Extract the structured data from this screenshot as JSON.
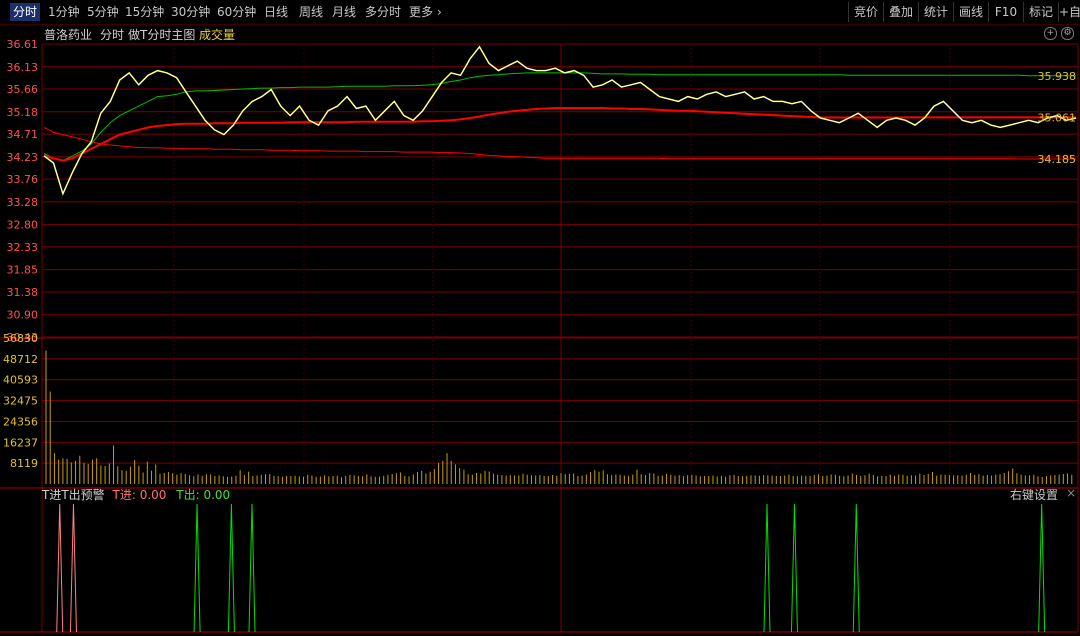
{
  "toolbar": {
    "tabs": [
      "分时",
      "1分钟",
      "5分钟",
      "15分钟",
      "30分钟",
      "60分钟",
      "日线",
      "周线",
      "月线",
      "多分时",
      "更多"
    ],
    "more_arrow": "›",
    "right_tabs": [
      "竞价",
      "叠加",
      "统计",
      "画线",
      "F10",
      "标记",
      "+自"
    ]
  },
  "info": {
    "stock_name": "普洛药业",
    "mode": "分时",
    "chart_name": "做T分时主图",
    "volume_label": "成交量"
  },
  "price_axis": [
    "36.61",
    "36.13",
    "35.66",
    "35.18",
    "34.71",
    "34.23",
    "33.76",
    "33.28",
    "32.80",
    "32.33",
    "31.85",
    "31.38",
    "30.90",
    "30.43"
  ],
  "volume_axis": [
    "56830",
    "48712",
    "40593",
    "32475",
    "24356",
    "16237",
    "8119"
  ],
  "line_labels": [
    "35.938",
    "35.061",
    "34.185"
  ],
  "indicator": {
    "title": "T进T出预警",
    "t_in": "T进: 0.00",
    "t_out": "T出: 0.00",
    "settings": "右键设置",
    "close": "×"
  },
  "colors": {
    "background": "#000000",
    "grid": "#7a0000",
    "price_line": "#ffffff",
    "avg_line": "#ffff00",
    "ma_red": "#ff0000",
    "ma_green": "#00c000",
    "axis_red": "#ff5050",
    "axis_yellow": "#e0c030",
    "volume_bar": "#c8a000",
    "t_in_spike": "#ff8080",
    "t_out_spike": "#00e000"
  },
  "chart_data": {
    "type": "line",
    "title": "",
    "ylim": [
      30.43,
      36.61
    ],
    "price": [
      34.25,
      34.1,
      33.45,
      33.9,
      34.3,
      34.55,
      35.15,
      35.4,
      35.85,
      36.0,
      35.75,
      35.95,
      36.05,
      36.0,
      35.9,
      35.6,
      35.3,
      35.0,
      34.8,
      34.7,
      34.9,
      35.2,
      35.4,
      35.5,
      35.65,
      35.3,
      35.1,
      35.3,
      35.0,
      34.9,
      35.2,
      35.3,
      35.5,
      35.25,
      35.3,
      35.0,
      35.2,
      35.4,
      35.1,
      35.0,
      35.2,
      35.5,
      35.8,
      36.0,
      35.95,
      36.3,
      36.55,
      36.2,
      36.05,
      36.15,
      36.25,
      36.1,
      36.05,
      36.05,
      36.1,
      36.0,
      36.05,
      35.95,
      35.7,
      35.75,
      35.85,
      35.7,
      35.75,
      35.8,
      35.65,
      35.5,
      35.45,
      35.4,
      35.5,
      35.45,
      35.55,
      35.6,
      35.5,
      35.55,
      35.6,
      35.45,
      35.5,
      35.4,
      35.4,
      35.35,
      35.4,
      35.2,
      35.05,
      35.0,
      34.95,
      35.05,
      35.15,
      35.0,
      34.85,
      35.0,
      35.05,
      35.0,
      34.9,
      35.05,
      35.3,
      35.4,
      35.2,
      35.0,
      34.95,
      35.0,
      34.9,
      34.85,
      34.9,
      34.95,
      35.0,
      34.95,
      35.05,
      35.1,
      35.0,
      35.05
    ],
    "series": [
      {
        "name": "",
        "values": [
          34.3,
          34.2,
          34.15,
          34.25,
          34.35,
          34.5,
          34.75,
          34.95,
          35.1,
          35.2,
          35.3,
          35.4,
          35.5,
          35.52,
          35.55,
          35.6,
          35.62,
          35.62,
          35.63,
          35.64,
          35.65,
          35.66,
          35.67,
          35.68,
          35.68,
          35.69,
          35.69,
          35.7,
          35.7,
          35.7,
          35.7,
          35.71,
          35.72,
          35.72,
          35.72,
          35.72,
          35.72,
          35.73,
          35.73,
          35.73,
          35.74,
          35.75,
          35.78,
          35.82,
          35.85,
          35.9,
          35.93,
          35.95,
          35.96,
          35.98,
          35.99,
          36.0,
          36.0,
          36.0,
          36.0,
          36.0,
          36.0,
          36.0,
          35.99,
          35.98,
          35.98,
          35.98,
          35.97,
          35.97,
          35.97,
          35.96,
          35.96,
          35.96,
          35.96,
          35.96,
          35.96,
          35.96,
          35.96,
          35.96,
          35.96,
          35.96,
          35.96,
          35.96,
          35.96,
          35.96,
          35.96,
          35.96,
          35.96,
          35.96,
          35.96,
          35.95,
          35.95,
          35.95,
          35.95,
          35.95,
          35.95,
          35.95,
          35.95,
          35.95,
          35.95,
          35.95,
          35.95,
          35.95,
          35.95,
          35.95,
          35.95,
          35.95,
          35.95,
          35.95,
          35.94,
          35.94,
          35.94,
          35.94,
          35.94,
          35.938
        ]
      },
      {
        "name": "",
        "values": [
          34.25,
          34.2,
          34.15,
          34.2,
          34.3,
          34.4,
          34.5,
          34.6,
          34.7,
          34.75,
          34.8,
          34.85,
          34.88,
          34.9,
          34.92,
          34.93,
          34.93,
          34.93,
          34.94,
          34.94,
          34.94,
          34.95,
          34.95,
          34.95,
          34.95,
          34.95,
          34.96,
          34.96,
          34.96,
          34.96,
          34.96,
          34.96,
          34.96,
          34.97,
          34.97,
          34.97,
          34.97,
          34.97,
          34.97,
          34.97,
          34.98,
          34.98,
          34.99,
          35.0,
          35.02,
          35.05,
          35.08,
          35.12,
          35.15,
          35.18,
          35.2,
          35.22,
          35.24,
          35.25,
          35.26,
          35.26,
          35.26,
          35.26,
          35.26,
          35.26,
          35.25,
          35.25,
          35.24,
          35.24,
          35.23,
          35.22,
          35.21,
          35.2,
          35.2,
          35.19,
          35.18,
          35.17,
          35.16,
          35.15,
          35.14,
          35.13,
          35.12,
          35.11,
          35.1,
          35.09,
          35.08,
          35.07,
          35.06,
          35.06,
          35.06,
          35.06,
          35.06,
          35.06,
          35.06,
          35.06,
          35.06,
          35.061,
          35.061,
          35.061,
          35.061,
          35.061,
          35.061,
          35.061,
          35.061,
          35.061,
          35.061,
          35.061,
          35.061,
          35.061,
          35.061,
          35.061,
          35.061,
          35.061,
          35.061,
          35.061
        ]
      },
      {
        "name": "",
        "values": [
          34.85,
          34.75,
          34.7,
          34.65,
          34.6,
          34.55,
          34.5,
          34.48,
          34.46,
          34.44,
          34.43,
          34.42,
          34.42,
          34.41,
          34.41,
          34.4,
          34.4,
          34.4,
          34.39,
          34.39,
          34.39,
          34.38,
          34.38,
          34.38,
          34.37,
          34.37,
          34.37,
          34.36,
          34.36,
          34.36,
          34.35,
          34.35,
          34.35,
          34.35,
          34.34,
          34.34,
          34.34,
          34.34,
          34.33,
          34.33,
          34.33,
          34.33,
          34.32,
          34.32,
          34.31,
          34.3,
          34.28,
          34.26,
          34.25,
          34.24,
          34.23,
          34.22,
          34.21,
          34.2,
          34.2,
          34.2,
          34.2,
          34.2,
          34.2,
          34.2,
          34.2,
          34.2,
          34.2,
          34.2,
          34.2,
          34.2,
          34.19,
          34.19,
          34.19,
          34.19,
          34.19,
          34.19,
          34.19,
          34.19,
          34.19,
          34.19,
          34.19,
          34.19,
          34.19,
          34.19,
          34.19,
          34.19,
          34.19,
          34.19,
          34.19,
          34.19,
          34.19,
          34.19,
          34.19,
          34.19,
          34.19,
          34.19,
          34.19,
          34.19,
          34.19,
          34.19,
          34.19,
          34.19,
          34.19,
          34.19,
          34.19,
          34.19,
          34.19,
          34.185,
          34.185,
          34.185,
          34.185,
          34.185,
          34.185,
          34.185
        ]
      }
    ],
    "volume": {
      "ylim": [
        0,
        56830
      ],
      "values": [
        52000,
        36000,
        12000,
        9500,
        10000,
        9800,
        8400,
        9000,
        11000,
        8200,
        7800,
        9500,
        10000,
        7200,
        7000,
        8000,
        15000,
        6900,
        5400,
        5100,
        6800,
        9300,
        7100,
        4500,
        8700,
        5200,
        7600,
        4000,
        4300,
        4700,
        4200,
        3600,
        4200,
        3900,
        3400,
        3000,
        3700,
        3200,
        3800,
        3700,
        3100,
        3400,
        3000,
        2800,
        2900,
        3200,
        5400,
        3500,
        4800,
        3100,
        3300,
        3600,
        3800,
        3900,
        3200,
        3000,
        2900,
        3100,
        3100,
        3200,
        3000,
        2800,
        3600,
        3300,
        2800,
        2900,
        3400,
        3000,
        3100,
        3200,
        2600,
        3100,
        3500,
        3400,
        3100,
        3000,
        3700,
        3000,
        2800,
        2900,
        3200,
        3600,
        3900,
        4200,
        4500,
        3100,
        3000,
        3700,
        4700,
        5100,
        4100,
        4800,
        5800,
        8200,
        9000,
        12000,
        9000,
        7600,
        6200,
        5600,
        3800,
        3600,
        4300,
        4100,
        5100,
        4900,
        4000,
        3600,
        3500,
        3300,
        3400,
        3300,
        3300,
        4000,
        3600,
        3400,
        3300,
        3500,
        3200,
        3100,
        3500,
        3200,
        4200,
        3800,
        3900,
        4100,
        3100,
        3300,
        3700,
        4600,
        5400,
        4800,
        5300,
        3800,
        3400,
        3700,
        3600,
        3300,
        3200,
        3600,
        5600,
        3800,
        3500,
        4200,
        4000,
        3200,
        3300,
        3900,
        3600,
        3200,
        3400,
        3100,
        3400,
        3600,
        3300,
        3000,
        3100,
        3200,
        3300,
        2900,
        3200,
        2900,
        3400,
        3600,
        3100,
        3000,
        3200,
        3400,
        3300,
        3200,
        3500,
        3400,
        3300,
        3200,
        3100,
        3300,
        3600,
        3100,
        3000,
        3300,
        3200,
        3100,
        3500,
        3800,
        3100,
        3300,
        3700,
        3600,
        3200,
        3000,
        3300,
        4100,
        3500,
        3200,
        3400,
        4000,
        3500,
        3000,
        3200,
        3100,
        3600,
        3200,
        3700,
        3600,
        3200,
        3400,
        3300,
        4000,
        3500,
        3900,
        4700,
        3200,
        3700,
        3600,
        3500,
        3300,
        3400,
        3300,
        3600,
        4300,
        3600,
        3800,
        3300,
        3500,
        3300,
        3700,
        3800,
        4300,
        5000,
        6000,
        4200,
        3600,
        3300,
        3400,
        3600,
        3000,
        2800,
        3100,
        3300,
        3500,
        3700,
        3900,
        4100,
        3600
      ]
    },
    "t_signals": {
      "t_in_index": [
        2,
        4
      ],
      "t_out_index": [
        22,
        27,
        30,
        105,
        109,
        118,
        145
      ]
    }
  }
}
